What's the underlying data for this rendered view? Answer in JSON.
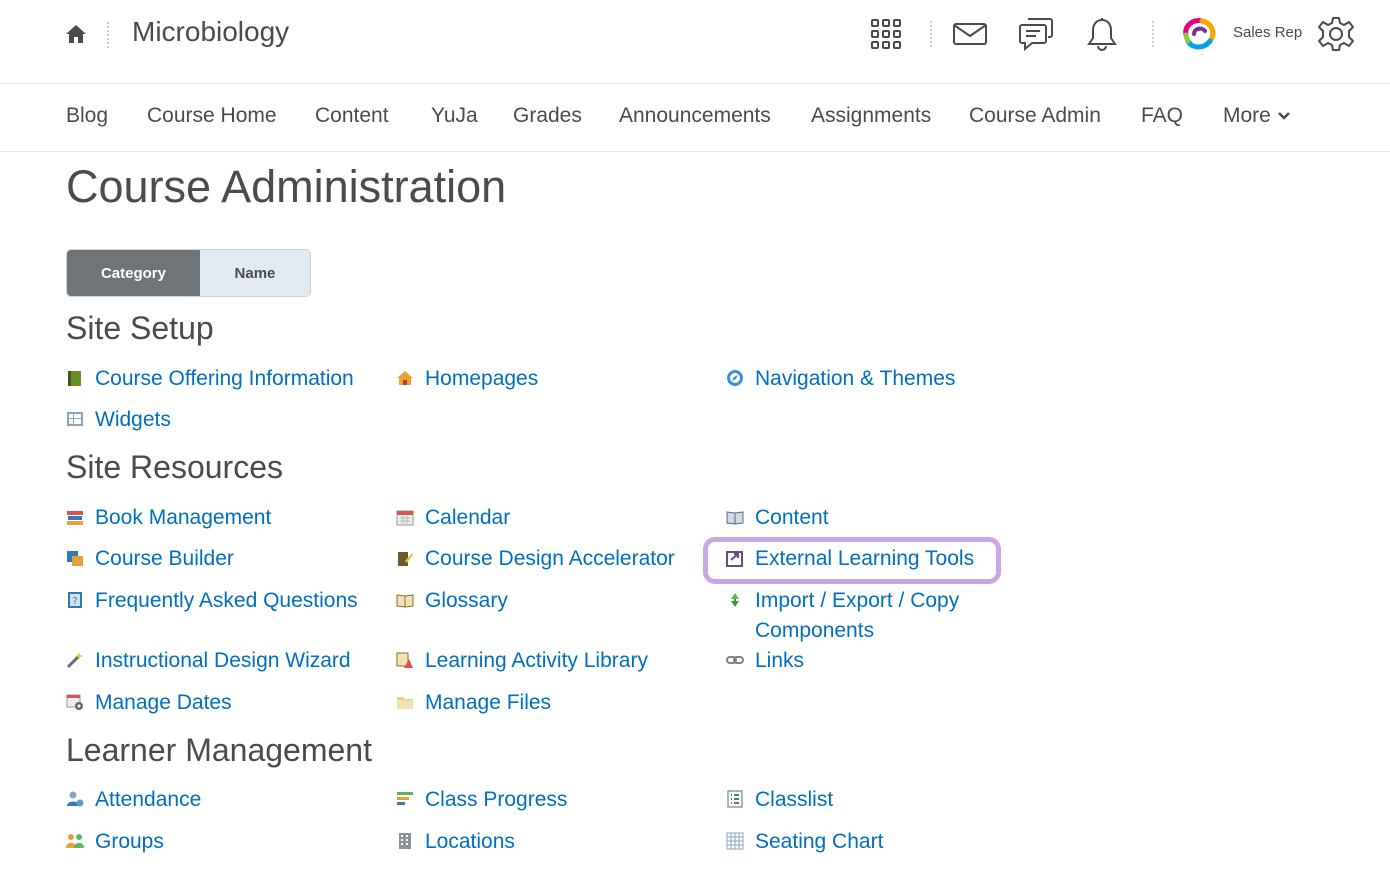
{
  "header": {
    "course_title": "Microbiology",
    "user_name": "Sales Rep",
    "icons": [
      "home-icon",
      "waffle-grid-icon",
      "email-icon",
      "chat-icon",
      "bell-icon",
      "user-logo",
      "gear-icon"
    ]
  },
  "nav": {
    "items": [
      "Blog",
      "Course Home",
      "Content",
      "YuJa",
      "Grades",
      "Announcements",
      "Assignments",
      "Course Admin",
      "FAQ"
    ],
    "more_label": "More"
  },
  "page": {
    "title": "Course Administration",
    "toggle": {
      "active": "Category",
      "inactive": "Name"
    }
  },
  "sections": {
    "site_setup": {
      "title": "Site Setup",
      "tools": [
        "Course Offering Information",
        "Homepages",
        "Navigation & Themes",
        "Widgets"
      ]
    },
    "site_resources": {
      "title": "Site Resources",
      "tools": [
        "Book Management",
        "Calendar",
        "Content",
        "Course Builder",
        "Course Design Accelerator",
        "External Learning Tools",
        "Frequently Asked Questions",
        "Glossary",
        "Import / Export / Copy Components",
        "Instructional Design Wizard",
        "Learning Activity Library",
        "Links",
        "Manage Dates",
        "Manage Files"
      ]
    },
    "learner_management": {
      "title": "Learner Management",
      "tools": [
        "Attendance",
        "Class Progress",
        "Classlist",
        "Groups",
        "Locations",
        "Seating Chart"
      ]
    }
  },
  "colors": {
    "link": "#006fbf",
    "text": "#494c4e",
    "highlight": "#c9a6e4",
    "toggle_active": "#6e7477",
    "toggle_inactive": "#e3e9f1"
  }
}
